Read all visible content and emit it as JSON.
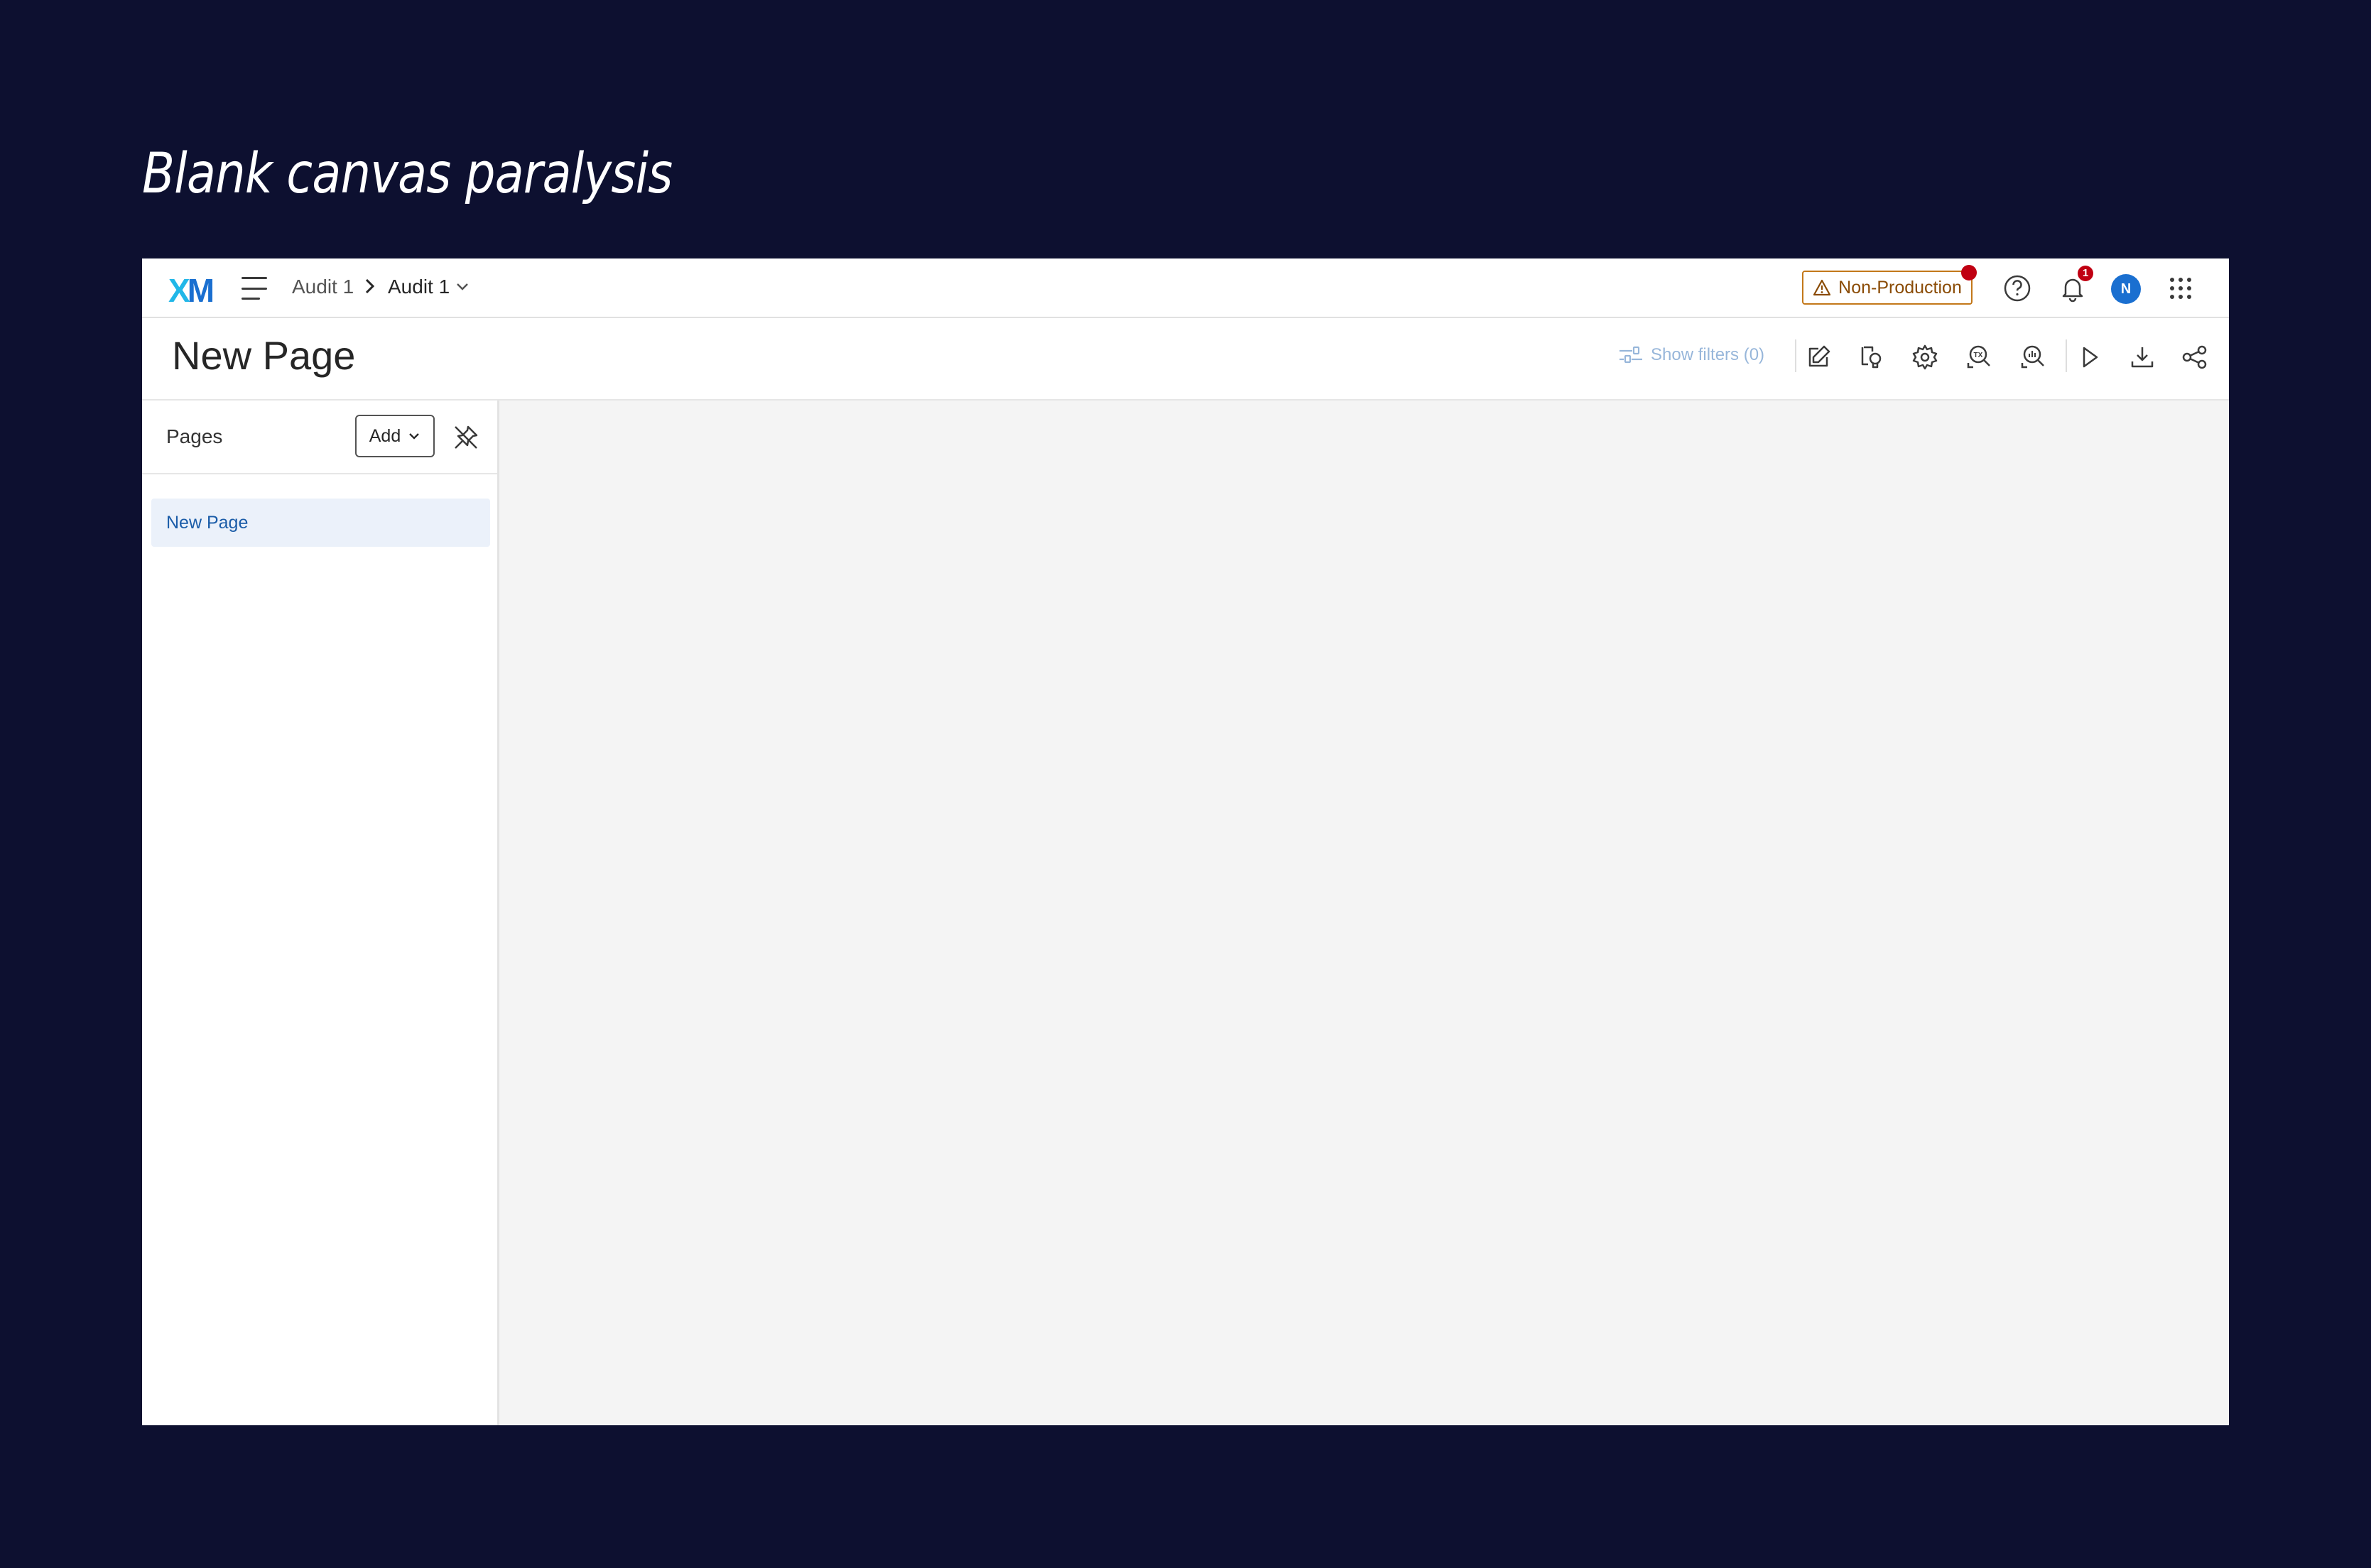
{
  "slide": {
    "title": "Blank canvas paralysis"
  },
  "topnav": {
    "logo_x": "X",
    "logo_m": "M",
    "breadcrumb": [
      "Audit 1",
      "Audit 1"
    ],
    "environment_badge": "Non-Production",
    "notification_count": "1",
    "avatar_initial": "N"
  },
  "header": {
    "page_title": "New Page",
    "show_filters": "Show filters (0)"
  },
  "sidebar": {
    "title": "Pages",
    "add_label": "Add",
    "items": [
      {
        "label": "New Page",
        "selected": true
      }
    ]
  },
  "colors": {
    "background": "#0d1030",
    "accent": "#1a6fd0",
    "warning": "#c3781a",
    "badge": "#c00012"
  }
}
